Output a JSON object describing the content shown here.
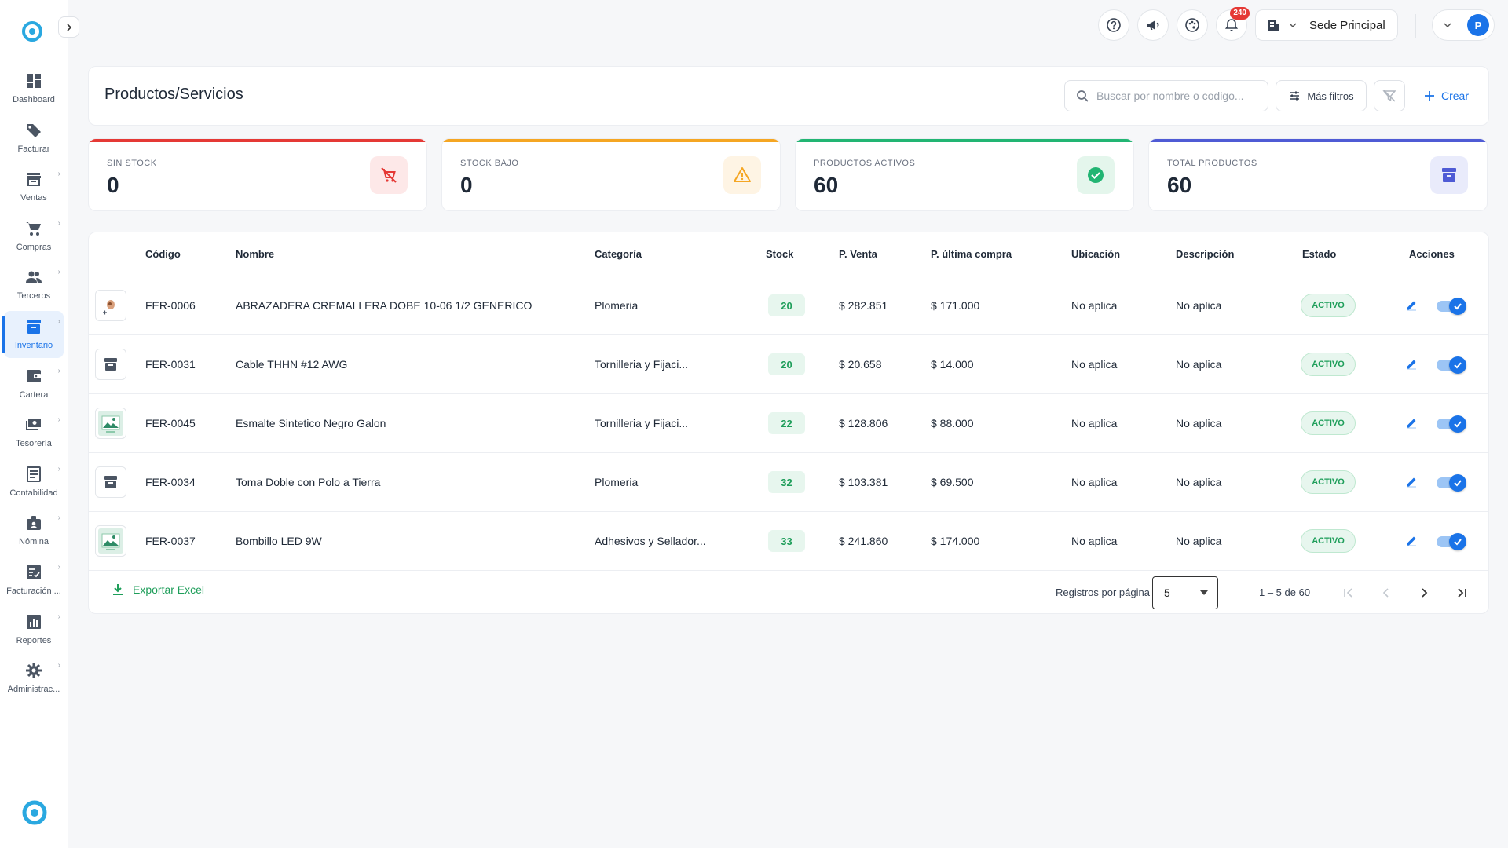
{
  "sidebar": {
    "items": [
      {
        "label": "Dashboard",
        "icon": "dashboard-icon"
      },
      {
        "label": "Facturar",
        "icon": "tag-icon"
      },
      {
        "label": "Ventas",
        "icon": "store-icon"
      },
      {
        "label": "Compras",
        "icon": "cart-icon"
      },
      {
        "label": "Terceros",
        "icon": "people-icon"
      },
      {
        "label": "Inventario",
        "icon": "archive-icon"
      },
      {
        "label": "Cartera",
        "icon": "wallet-icon"
      },
      {
        "label": "Tesorería",
        "icon": "cash-icon"
      },
      {
        "label": "Contabilidad",
        "icon": "ledger-icon"
      },
      {
        "label": "Nómina",
        "icon": "badge-icon"
      },
      {
        "label": "Facturación ...",
        "icon": "invoice-check-icon"
      },
      {
        "label": "Reportes",
        "icon": "chart-icon"
      },
      {
        "label": "Administrac...",
        "icon": "gear-icon"
      }
    ],
    "active": "Inventario"
  },
  "topbar": {
    "notifications_count": "240",
    "branch": "Sede Principal",
    "avatar_initial": "P"
  },
  "header": {
    "title": "Productos/Servicios",
    "search_placeholder": "Buscar por nombre o codigo...",
    "more_filters": "Más filtros",
    "create": "Crear"
  },
  "stats": [
    {
      "label": "SIN STOCK",
      "value": "0",
      "color": "#e53935",
      "icon": "no-cart-icon"
    },
    {
      "label": "STOCK BAJO",
      "value": "0",
      "color": "#f5a623",
      "icon": "warning-icon"
    },
    {
      "label": "PRODUCTOS ACTIVOS",
      "value": "60",
      "color": "#22b573",
      "icon": "check-circle-icon"
    },
    {
      "label": "TOTAL PRODUCTOS",
      "value": "60",
      "color": "#4f5bd5",
      "icon": "archive-icon"
    }
  ],
  "table": {
    "columns": [
      "Código",
      "Nombre",
      "Categoría",
      "Stock",
      "P. Venta",
      "P. última compra",
      "Ubicación",
      "Descripción",
      "Estado",
      "Acciones"
    ],
    "rows": [
      {
        "thumb": "photo",
        "code": "FER-0006",
        "name": "ABRAZADERA CREMALLERA DOBE 10-06 1/2 GENERICO",
        "category": "Plomeria",
        "stock": "20",
        "price": "$ 282.851",
        "last_price": "$ 171.000",
        "location": "No aplica",
        "description": "No aplica",
        "status": "ACTIVO"
      },
      {
        "thumb": "box",
        "code": "FER-0031",
        "name": "Cable THHN #12 AWG",
        "category": "Tornilleria y Fijaci...",
        "stock": "20",
        "price": "$ 20.658",
        "last_price": "$ 14.000",
        "location": "No aplica",
        "description": "No aplica",
        "status": "ACTIVO"
      },
      {
        "thumb": "image",
        "code": "FER-0045",
        "name": "Esmalte Sintetico Negro Galon",
        "category": "Tornilleria y Fijaci...",
        "stock": "22",
        "price": "$ 128.806",
        "last_price": "$ 88.000",
        "location": "No aplica",
        "description": "No aplica",
        "status": "ACTIVO"
      },
      {
        "thumb": "box",
        "code": "FER-0034",
        "name": "Toma Doble con Polo a Tierra",
        "category": "Plomeria",
        "stock": "32",
        "price": "$ 103.381",
        "last_price": "$ 69.500",
        "location": "No aplica",
        "description": "No aplica",
        "status": "ACTIVO"
      },
      {
        "thumb": "image",
        "code": "FER-0037",
        "name": "Bombillo LED 9W",
        "category": "Adhesivos y Sellador...",
        "stock": "33",
        "price": "$ 241.860",
        "last_price": "$ 174.000",
        "location": "No aplica",
        "description": "No aplica",
        "status": "ACTIVO"
      }
    ]
  },
  "footer": {
    "export": "Exportar Excel",
    "per_page_label": "Registros por página",
    "per_page_value": "5",
    "range": "1 – 5 de 60"
  },
  "colors": {
    "accent": "#1a73e8",
    "success": "#1e9e5a"
  }
}
